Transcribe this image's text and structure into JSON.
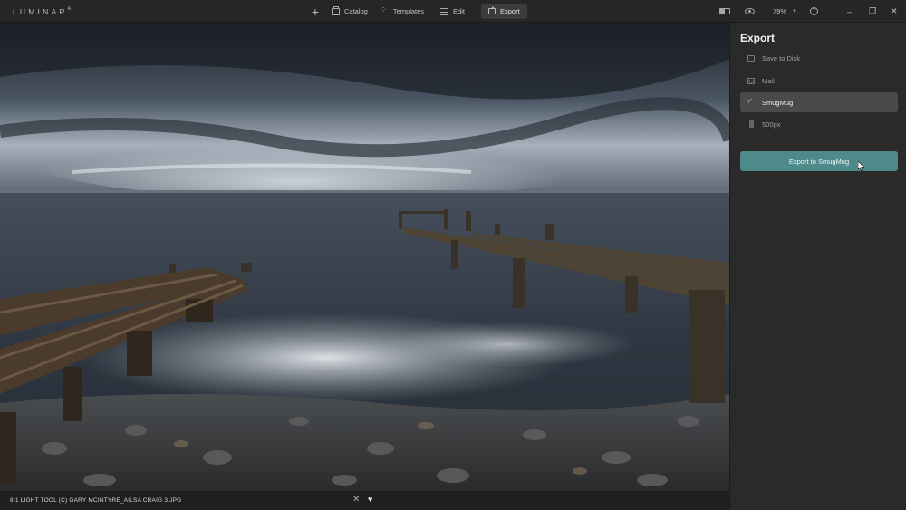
{
  "app": {
    "logo_text": "LUMINAR",
    "logo_super": "AI"
  },
  "topbar": {
    "add_icon": "plus-icon",
    "tabs": [
      {
        "label": "Catalog",
        "icon": "folder-icon"
      },
      {
        "label": "Templates",
        "icon": "templates-icon"
      },
      {
        "label": "Edit",
        "icon": "sliders-icon"
      },
      {
        "label": "Export",
        "icon": "export-icon",
        "active": true
      }
    ],
    "zoom": "79%",
    "window_controls": {
      "minimize": "–",
      "restore": "❐",
      "close": "✕"
    }
  },
  "photo": {
    "filename": "8.1 LIGHT TOOL (C) GARY MCINTYRE_AILSA CRAIG 3.JPG"
  },
  "export_panel": {
    "title": "Export",
    "options": [
      {
        "label": "Save to Disk",
        "icon": "folder-icon",
        "selected": false
      },
      {
        "label": "Mail",
        "icon": "mail-icon",
        "selected": false
      },
      {
        "label": "SmugMug",
        "icon": "smugmug-icon",
        "selected": true
      },
      {
        "label": "500px",
        "icon": "500px-icon",
        "selected": false
      }
    ],
    "action_label": "Export to SmugMug"
  },
  "colors": {
    "accent": "#4f8a8b",
    "background": "#232323",
    "panel": "#2a2a2a"
  }
}
